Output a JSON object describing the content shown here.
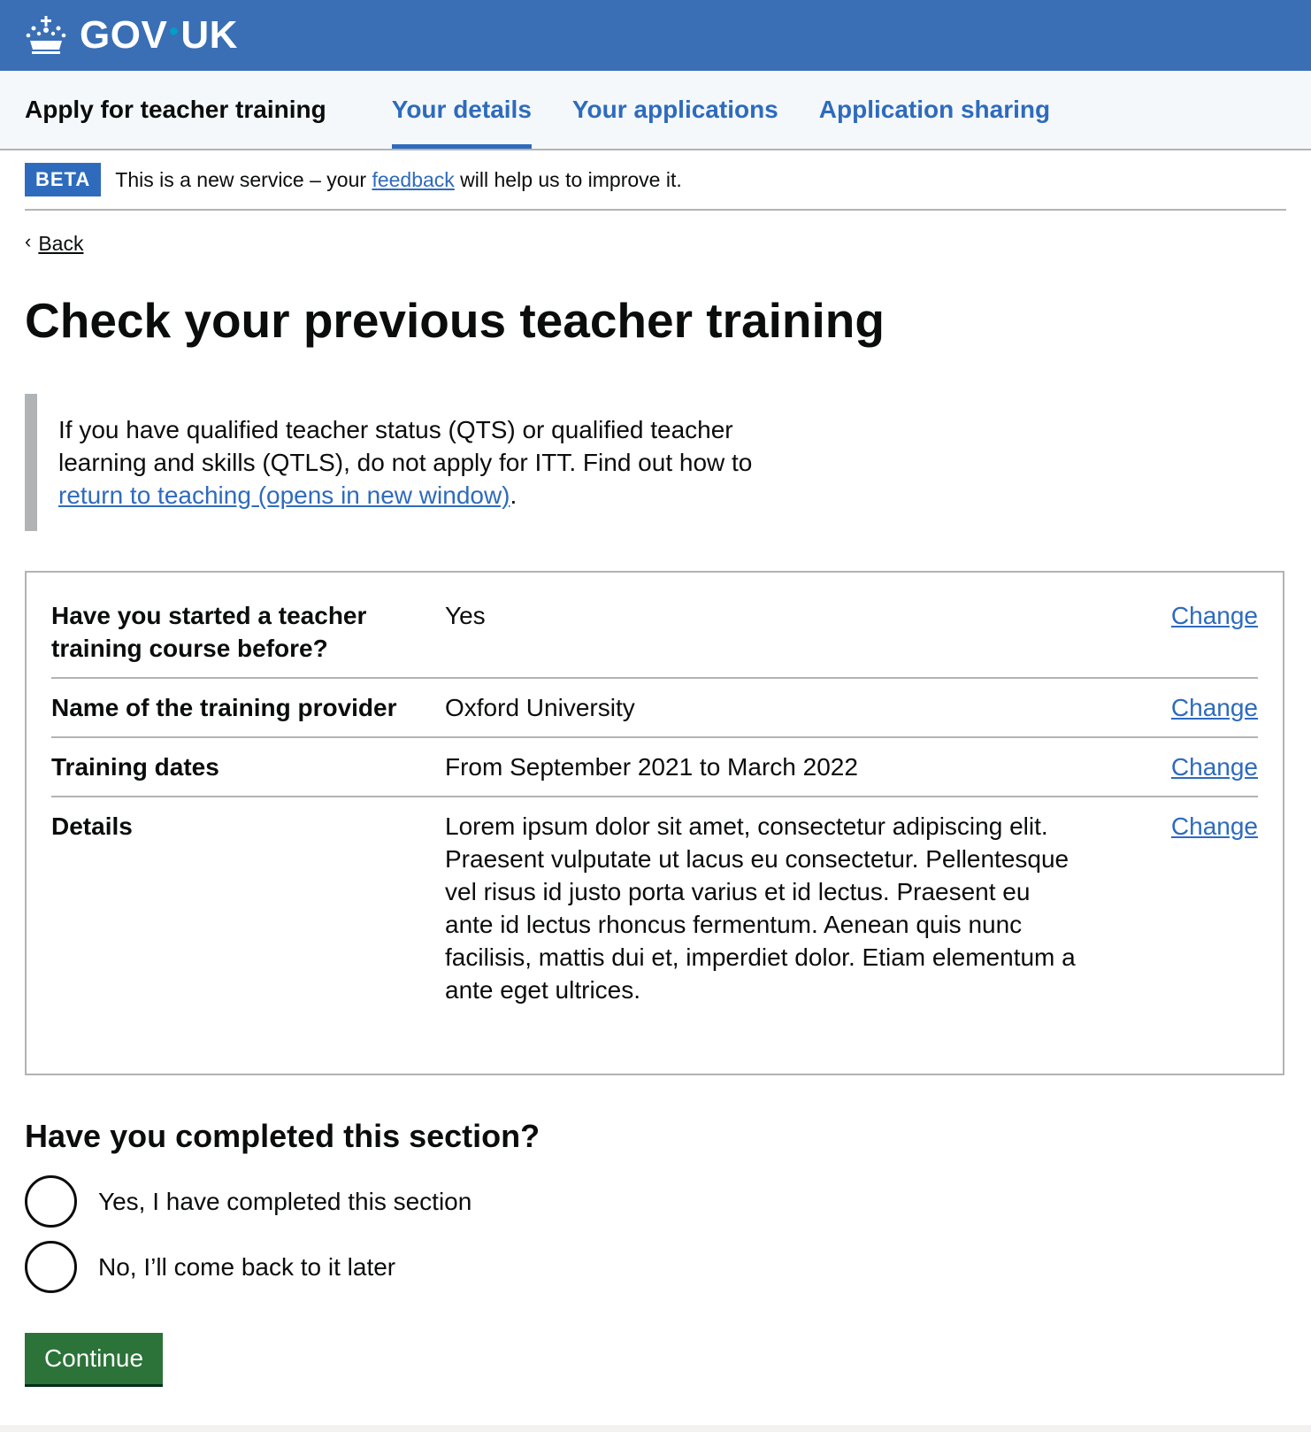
{
  "header": {
    "logo_text_left": "GOV",
    "logo_dot": "•",
    "logo_text_right": "UK",
    "crown_icon": "crown-icon"
  },
  "service_nav": {
    "service_name": "Apply for teacher training",
    "items": [
      {
        "label": "Your details",
        "active": true
      },
      {
        "label": "Your applications",
        "active": false
      },
      {
        "label": "Application sharing",
        "active": false
      }
    ]
  },
  "beta": {
    "tag": "BETA",
    "text_before": "This is a new service – your ",
    "link": "feedback",
    "text_after": " will help us to improve it."
  },
  "back": {
    "label": "Back",
    "icon": "chevron-left-icon"
  },
  "page_title": "Check your previous teacher training",
  "inset": {
    "text": "If you have qualified teacher status (QTS) or qualified teacher learning and skills (QTLS), do not apply for ITT. Find out how to ",
    "link": "return to teaching (opens in new window)",
    "after_link": "."
  },
  "summary": {
    "rows": [
      {
        "key": "Have you started a teacher training course before?",
        "value": "Yes",
        "action": "Change"
      },
      {
        "key": "Name of the training provider",
        "value": "Oxford University",
        "action": "Change"
      },
      {
        "key": "Training dates",
        "value": "From September 2021 to March 2022",
        "action": "Change"
      },
      {
        "key": "Details",
        "value": "Lorem ipsum dolor sit amet, consectetur adipiscing elit. Praesent vulputate ut lacus eu consectetur. Pellentesque vel risus id justo porta varius et id lectus. Praesent eu ante id lectus rhoncus fermentum. Aenean quis nunc facilisis, mattis dui et, imperdiet dolor. Etiam elementum a ante eget ultrices.",
        "action": "Change"
      }
    ]
  },
  "completion": {
    "question": "Have you completed this section?",
    "options": [
      "Yes, I have completed this section",
      "No, I’ll come back to it later"
    ],
    "button": "Continue"
  },
  "colors": {
    "header_blue": "#3a6fb5",
    "link_blue": "#2e6bbd",
    "button_green": "#2b7338",
    "border_grey": "#b1b4b6"
  }
}
